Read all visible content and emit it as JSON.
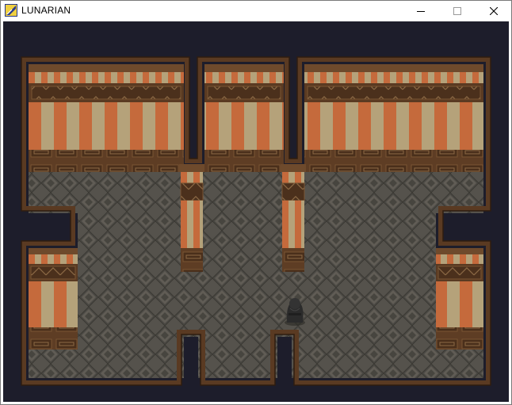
{
  "window": {
    "title": "LUNARIAN",
    "icon": "app-icon",
    "controls": [
      "minimize-icon",
      "maximize-icon",
      "close-icon"
    ]
  },
  "scene": {
    "kind": "top-down interior map",
    "background_color": "#1d1d2b",
    "floor_color": "#55524c",
    "wall_trim_color": "#5a3a22",
    "stripe_colors": [
      "#b88a52",
      "#c56a3c",
      "#b5a27a"
    ],
    "character": "dark-hooded-figure"
  }
}
